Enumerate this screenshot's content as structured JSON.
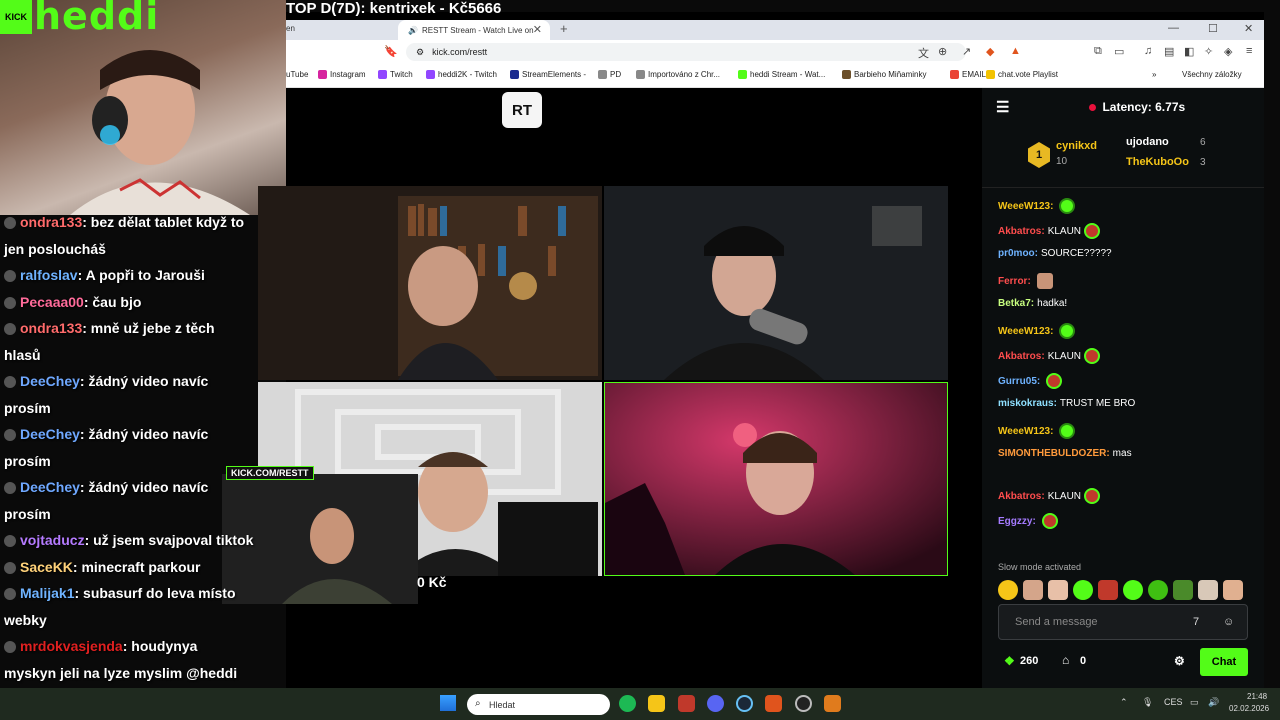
{
  "overlay": {
    "kick_label": "KICK",
    "channel_name": "heddi",
    "top_banner": "TOP D(7D): kentrixek - Kč5666",
    "cam_watermark": "KICK.COM/RESTT",
    "total_amount": "0 Kč"
  },
  "browser": {
    "tab_left_stub": "en",
    "tab_title": "RESTT Stream - Watch Live on",
    "url": "kick.com/restt",
    "bookmarks": [
      {
        "label": "uTube",
        "icon_color": "#ff0000"
      },
      {
        "label": "Instagram",
        "icon_color": "#d6249f"
      },
      {
        "label": "Twitch",
        "icon_color": "#9146ff"
      },
      {
        "label": "heddi2K - Twitch",
        "icon_color": "#9146ff"
      },
      {
        "label": "StreamElements -",
        "icon_color": "#1b2b8f"
      },
      {
        "label": "PD",
        "icon_color": "#888888"
      },
      {
        "label": "Importováno z Chr...",
        "icon_color": "#888888"
      },
      {
        "label": "heddi Stream - Wat...",
        "icon_color": "#53fc18"
      },
      {
        "label": "Barbieho Miňaminky",
        "icon_color": "#6b4f2a"
      },
      {
        "label": "EMAIL",
        "icon_color": "#ea4335"
      },
      {
        "label": "chat.vote Playlist",
        "icon_color": "#f2c200"
      }
    ],
    "all_bookmarks": "Všechny záložky"
  },
  "stream": {
    "logo": "RT"
  },
  "chat": {
    "latency": "Latency: 6.77s",
    "leaderboard": {
      "rank": "1",
      "first": {
        "name": "cynikxd",
        "count": "10"
      },
      "second": {
        "name": "ujodano",
        "count": "6"
      },
      "third": {
        "name": "TheKuboOo",
        "count": "3"
      }
    },
    "messages": [
      {
        "user": "WeeeW123:",
        "color": "#f5c518",
        "text": ""
      },
      {
        "user": "Akbatros:",
        "color": "#ff4d4d",
        "text": "KLAUN"
      },
      {
        "user": "pr0moo:",
        "color": "#6fb3ff",
        "text": "SOURCE?????"
      },
      {
        "user": "Ferror:",
        "color": "#ff4d4d",
        "text": ""
      },
      {
        "user": "Betka7:",
        "color": "#c8ff80",
        "text": "hadka!"
      },
      {
        "user": "WeeeW123:",
        "color": "#f5c518",
        "text": ""
      },
      {
        "user": "Akbatros:",
        "color": "#ff4d4d",
        "text": "KLAUN"
      },
      {
        "user": "Gurru05:",
        "color": "#6fb3ff",
        "text": ""
      },
      {
        "user": "miskokraus:",
        "color": "#8fe0ff",
        "text": "TRUST ME BRO"
      },
      {
        "user": "WeeeW123:",
        "color": "#f5c518",
        "text": ""
      },
      {
        "user": "SIMONTHEBULDOZER:",
        "color": "#ff9a3c",
        "text": "mas"
      },
      {
        "user": "Akbatros:",
        "color": "#ff4d4d",
        "text": "KLAUN"
      },
      {
        "user": "Eggzzy:",
        "color": "#a57bff",
        "text": ""
      }
    ],
    "slow_mode": "Slow mode activated",
    "send_placeholder": "Send a message",
    "points": "260",
    "store_count": "0",
    "chat_button": "Chat"
  },
  "overlay_chat": [
    {
      "user": "ondra133",
      "color": "#ff6b6b",
      "text": ": bez dělat tablet když to"
    },
    {
      "user": "",
      "color": "#ffffff",
      "text": "jen posloucháš"
    },
    {
      "user": "ralfoslav",
      "color": "#6fb3ff",
      "text": ": A popři to Jarouši"
    },
    {
      "user": "Pecaaa00",
      "color": "#ff6b9a",
      "text": ": čau bjo"
    },
    {
      "user": "ondra133",
      "color": "#ff6b6b",
      "text": ": mně už jebe z těch"
    },
    {
      "user": "",
      "color": "#ffffff",
      "text": "hlasů"
    },
    {
      "user": "DeeChey",
      "color": "#6fa8ff",
      "text": ": žádný video navíc"
    },
    {
      "user": "",
      "color": "#ffffff",
      "text": "prosím"
    },
    {
      "user": "DeeChey",
      "color": "#6fa8ff",
      "text": ": žádný video navíc"
    },
    {
      "user": "",
      "color": "#ffffff",
      "text": "prosím"
    },
    {
      "user": "DeeChey",
      "color": "#6fa8ff",
      "text": ": žádný video navíc"
    },
    {
      "user": "",
      "color": "#ffffff",
      "text": "prosím"
    },
    {
      "user": "vojtaducz",
      "color": "#b57bff",
      "text": ": už jsem svajpoval tiktok"
    },
    {
      "user": "SaceKK",
      "color": "#ffd27a",
      "text": ": minecraft parkour"
    },
    {
      "user": "Malijak1",
      "color": "#6fb3ff",
      "text": ": subasurf do leva místo"
    },
    {
      "user": "",
      "color": "#ffffff",
      "text": "webky"
    },
    {
      "user": "mrdokvasjenda",
      "color": "#e02020",
      "text": ": houdynya"
    },
    {
      "user": "",
      "color": "#ffffff",
      "text": "myskyn jeli na lyze myslim @heddi"
    }
  ],
  "taskbar": {
    "search_placeholder": "Hledat",
    "lang": "CES",
    "time": "21:48",
    "date": "02.02.2026"
  }
}
